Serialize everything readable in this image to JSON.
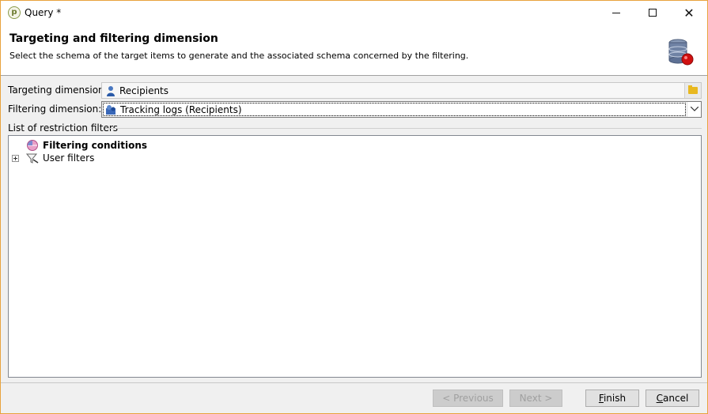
{
  "window": {
    "title": "Query *",
    "app_icon": "adobe-campaign-icon"
  },
  "header": {
    "title": "Targeting and filtering dimension",
    "subtitle": "Select the schema of the target items to  generate and the associated schema concerned by the filtering.",
    "icon": "database-icon"
  },
  "form": {
    "targeting_label": "Targeting dimension:",
    "targeting_value": "Recipients",
    "targeting_icon": "recipient-icon",
    "filtering_label": "Filtering dimension:",
    "filtering_value": "Tracking logs (Recipients)",
    "filtering_icon": "tracking-logs-icon"
  },
  "filters": {
    "group_label": "List of restriction filters",
    "items": [
      {
        "label": "Filtering conditions",
        "icon": "filtering-conditions-icon",
        "bold": true
      },
      {
        "label": "User filters",
        "icon": "user-filters-icon",
        "expandable": true
      }
    ]
  },
  "buttons": {
    "previous": "< Previous",
    "next": "Next >",
    "finish_first": "F",
    "finish_rest": "inish",
    "cancel_first": "C",
    "cancel_rest": "ancel"
  },
  "colors": {
    "window_border": "#e8a33d",
    "folder": "#e8b820",
    "db_badge": "#d01010"
  }
}
